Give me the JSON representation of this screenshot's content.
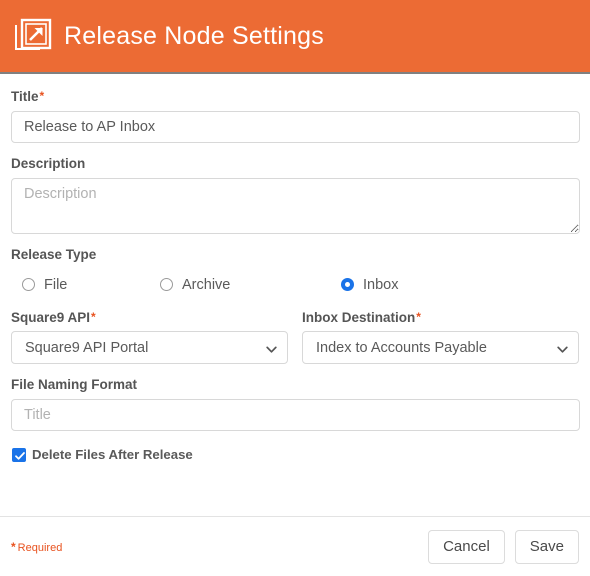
{
  "header": {
    "title": "Release Node Settings",
    "icon": "release-export-icon",
    "background_color": "#ec6b34",
    "text_color": "#ffffff"
  },
  "colors": {
    "accent_orange": "#ec6b34",
    "required_red": "#e8521f",
    "control_blue": "#1a73e8",
    "border_gray": "#d8d8d8",
    "label_gray": "#555555"
  },
  "form": {
    "title_field": {
      "label": "Title",
      "required_marker": "*",
      "value": "Release to AP Inbox",
      "placeholder": "Title"
    },
    "description_field": {
      "label": "Description",
      "value": "",
      "placeholder": "Description"
    },
    "release_type": {
      "label": "Release Type",
      "options": [
        {
          "label": "File",
          "selected": false
        },
        {
          "label": "Archive",
          "selected": false
        },
        {
          "label": "Inbox",
          "selected": true
        }
      ]
    },
    "square9_api": {
      "label": "Square9 API",
      "required_marker": "*",
      "selected": "Square9 API Portal"
    },
    "inbox_destination": {
      "label": "Inbox Destination",
      "required_marker": "*",
      "selected": "Index to Accounts Payable"
    },
    "file_naming_format": {
      "label": "File Naming Format",
      "value": "",
      "placeholder": "Title"
    },
    "delete_files": {
      "label": "Delete Files After Release",
      "checked": true
    }
  },
  "footer": {
    "required_star": "*",
    "required_text": "Required",
    "cancel_label": "Cancel",
    "save_label": "Save"
  }
}
